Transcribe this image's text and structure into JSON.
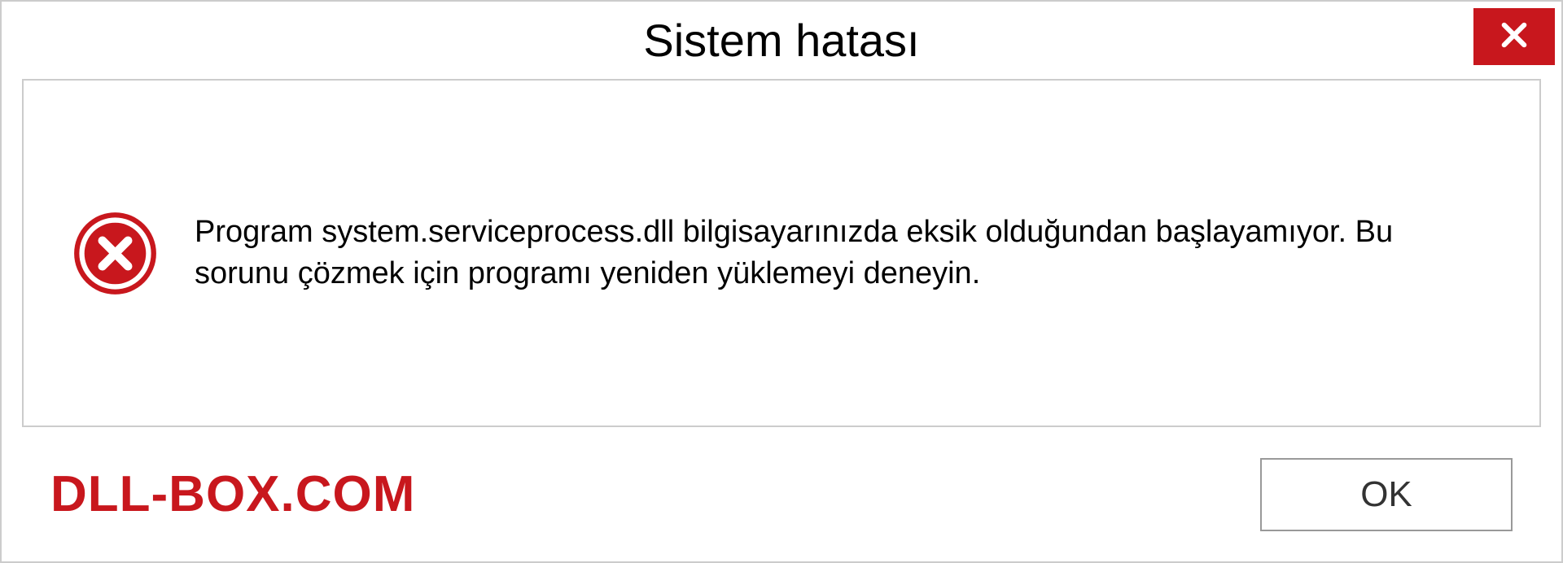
{
  "dialog": {
    "title": "Sistem hatası",
    "message": "Program system.serviceprocess.dll bilgisayarınızda eksik olduğundan başlayamıyor. Bu sorunu çözmek için programı yeniden yüklemeyi deneyin.",
    "ok_button_label": "OK"
  },
  "watermark": "DLL-BOX.COM",
  "colors": {
    "close_button_bg": "#c8171d",
    "error_icon_bg": "#c8171d",
    "watermark_color": "#c8171d"
  }
}
